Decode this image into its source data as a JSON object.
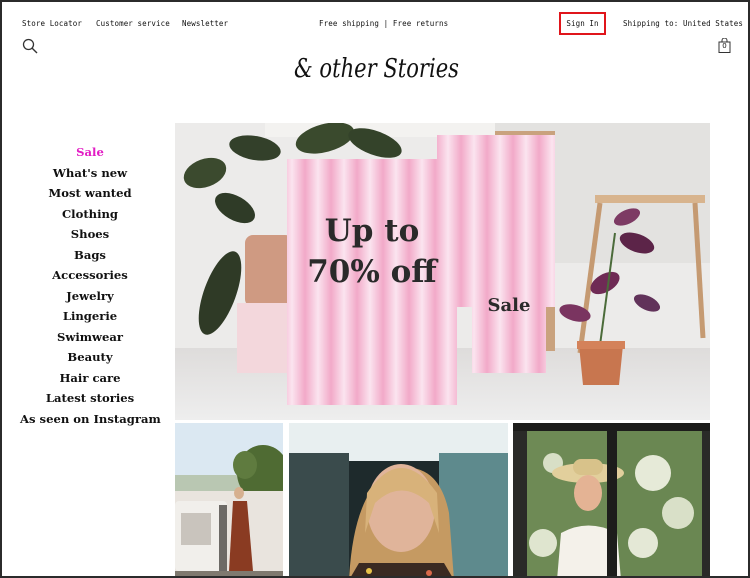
{
  "topbar": {
    "store_locator": "Store Locator",
    "customer_service": "Customer service",
    "newsletter": "Newsletter",
    "shipping_promo": "Free shipping | Free returns",
    "sign_in": "Sign In",
    "shipping_to": "Shipping to: United States"
  },
  "header": {
    "logo_text": "& other Stories",
    "bag_count": "0",
    "search_icon": "search-icon",
    "bag_icon": "shopping-bag-icon"
  },
  "nav": {
    "items": [
      {
        "label": "Sale"
      },
      {
        "label": "What's new"
      },
      {
        "label": "Most wanted"
      },
      {
        "label": "Clothing"
      },
      {
        "label": "Shoes"
      },
      {
        "label": "Bags"
      },
      {
        "label": "Accessories"
      },
      {
        "label": "Jewelry"
      },
      {
        "label": "Lingerie"
      },
      {
        "label": "Swimwear"
      },
      {
        "label": "Beauty"
      },
      {
        "label": "Hair care"
      },
      {
        "label": "Latest stories"
      },
      {
        "label": "As seen on Instagram"
      }
    ]
  },
  "hero": {
    "headline_line1": "Up to",
    "headline_line2": "70% off",
    "small_sign": "Sale"
  },
  "colors": {
    "sale_accent": "#e21cc4",
    "highlight_border": "#e0151b",
    "sign_pink": "#f4b5cf"
  }
}
